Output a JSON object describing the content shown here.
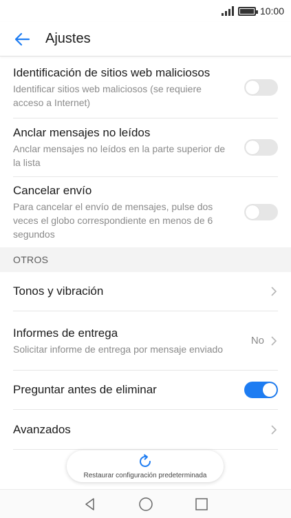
{
  "status_bar": {
    "time": "10:00"
  },
  "header": {
    "title": "Ajustes"
  },
  "settings_top": [
    {
      "title": "Identificación de sitios web maliciosos",
      "subtitle": "Identificar sitios web maliciosos (se requiere acceso a Internet)",
      "enabled": false
    },
    {
      "title": "Anclar mensajes no leídos",
      "subtitle": "Anclar mensajes no leídos en la parte superior de la lista",
      "enabled": false
    },
    {
      "title": "Cancelar envío",
      "subtitle": "Para cancelar el envío de mensajes, pulse dos veces el globo correspondiente en menos de 6 segundos",
      "enabled": false
    }
  ],
  "section_otros": {
    "label": "OTROS"
  },
  "otros": {
    "tones": {
      "title": "Tonos y vibración"
    },
    "delivery": {
      "title": "Informes de entrega",
      "subtitle": "Solicitar informe de entrega por mensaje enviado",
      "value": "No"
    },
    "ask_delete": {
      "title": "Preguntar antes de eliminar",
      "enabled": true
    },
    "advanced": {
      "title": "Avanzados"
    }
  },
  "restore": {
    "label": "Restaurar configuración predeterminada"
  },
  "colors": {
    "accent": "#1d7cf2",
    "toggle_off": "#e6e6e6",
    "section_bg": "#f3f3f3"
  },
  "icons": {
    "back": "arrow-left-icon",
    "chevron": "chevron-right-icon",
    "restore": "refresh-icon",
    "nav_back": "triangle-back-icon",
    "nav_home": "circle-home-icon",
    "nav_recents": "square-recents-icon"
  }
}
